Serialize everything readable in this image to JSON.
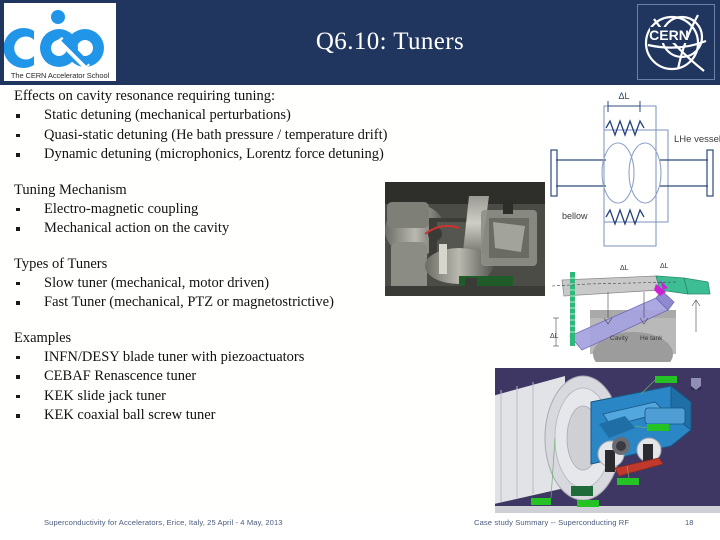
{
  "slide": {
    "title": "Q6.10: Tuners",
    "page_number": "18"
  },
  "logos": {
    "cas": {
      "name": "cas-logo",
      "caption": "The CERN Accelerator School",
      "color": "#2196e8"
    },
    "cern": {
      "name": "cern-logo",
      "text": "CERN",
      "color": "#ffffff"
    }
  },
  "sections": [
    {
      "heading": "Effects on cavity resonance requiring tuning:",
      "bullets": [
        "Static detuning (mechanical perturbations)",
        "Quasi-static detuning (He bath pressure / temperature drift)",
        "Dynamic detuning (microphonics, Lorentz force detuning)"
      ]
    },
    {
      "heading": "Tuning Mechanism",
      "bullets": [
        "Electro-magnetic coupling",
        "Mechanical action on the cavity"
      ]
    },
    {
      "heading": "Types of Tuners",
      "bullets": [
        "Slow tuner  (mechanical, motor driven)",
        "Fast Tuner  (mechanical, PTZ or magnetostrictive)"
      ]
    },
    {
      "heading": "Examples",
      "bullets": [
        "INFN/DESY blade tuner with piezoactuators",
        "CEBAF Renascence tuner",
        "KEK slide jack tuner",
        "KEK coaxial ball screw tuner"
      ]
    }
  ],
  "figures": {
    "cavity_schematic": {
      "name": "cavity-tuner-schematic",
      "labels": {
        "delta_l": "ΔL",
        "lhe_vessel": "LHe vessel",
        "bellow": "bellow"
      },
      "line_color": "#2d4a7a"
    },
    "lever_diagram": {
      "name": "lever-tuner-diagram",
      "labels": {
        "delta_l_cavity": "ΔL",
        "delta_l_arm": "ΔL",
        "delta_l_screw": "ΔL",
        "cavity": "Cavity",
        "he_tank": "He tank"
      }
    },
    "photo": {
      "name": "tuner-photograph"
    },
    "cad": {
      "name": "cad-tuner-assembly",
      "background": "#3b3560",
      "part_color": "#2b86c5",
      "label_color": "#25c225"
    }
  },
  "footer": {
    "left": "Superconductivity for Accelerators, Erice, Italy, 25 April - 4 May, 2013",
    "center": "Case study Summary -- Superconducting RF"
  },
  "theme": {
    "header_bg": "#21365f",
    "body_bg": "#fffffe",
    "text_color": "#121212",
    "footer_text": "#4a5b7c"
  }
}
